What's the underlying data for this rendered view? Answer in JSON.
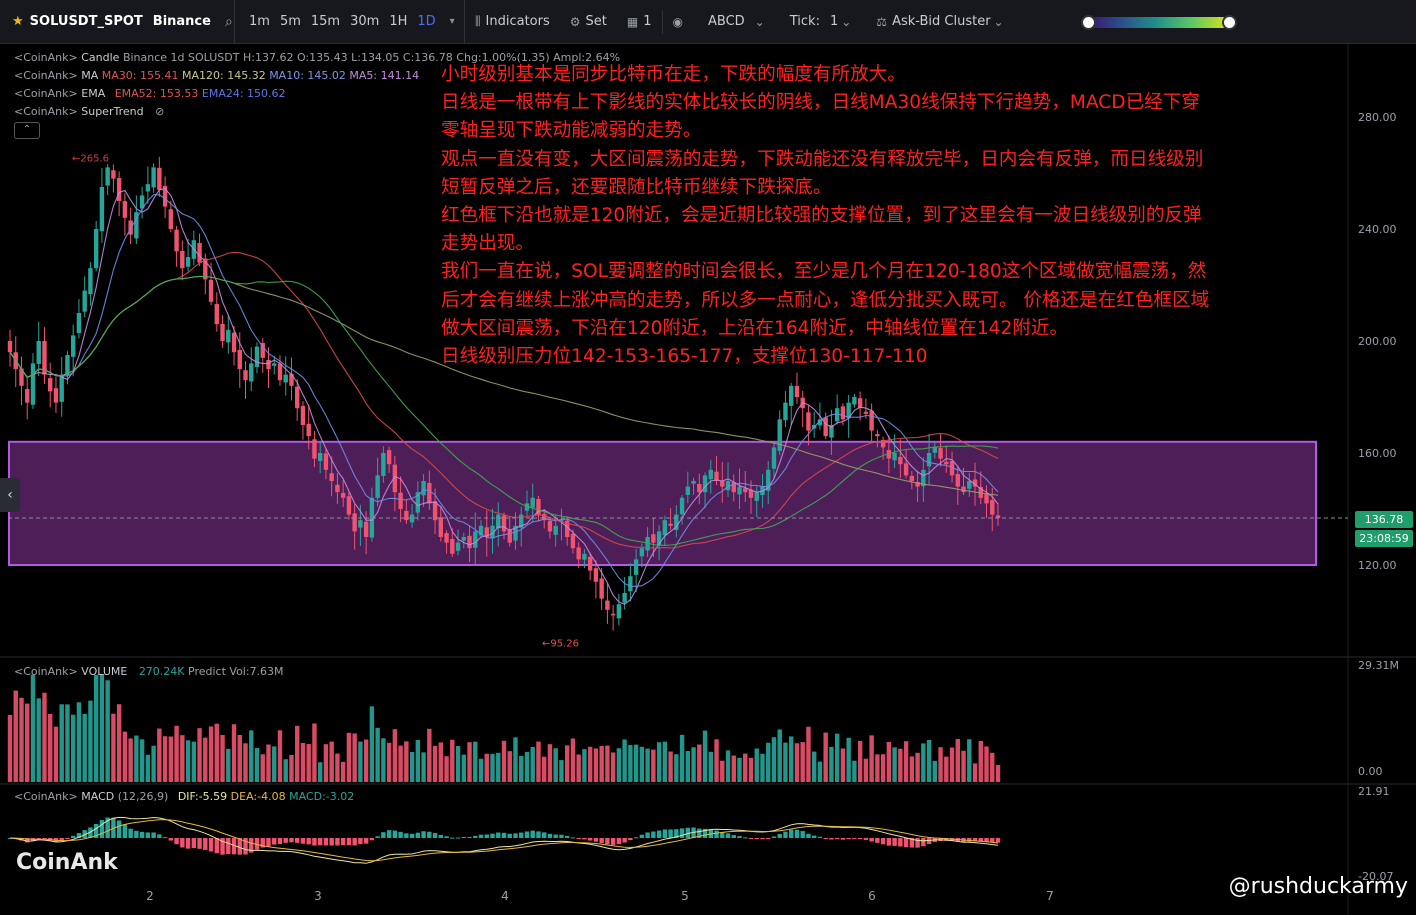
{
  "toolbar": {
    "symbol": "SOLUSDT_SPOT",
    "exchange": "Binance",
    "timeframes": [
      "1m",
      "5m",
      "15m",
      "30m",
      "1H",
      "1D"
    ],
    "active_timeframe": "1D",
    "indicators_label": "Indicators",
    "set_label": "Set",
    "layout_label": "1",
    "abcd_label": "ABCD",
    "tick_label": "Tick:",
    "tick_value": "1",
    "cluster_label": "Ask-Bid Cluster"
  },
  "legend": {
    "candle": {
      "prefix": "<CoinAnk>",
      "name": "Candle",
      "info": "Binance 1d SOLUSDT",
      "values": "H:137.62  O:135.43  L:134.05  C:136.78  Chg:1.00%(1.35)  Ampl:2.64%"
    },
    "ma": {
      "prefix": "<CoinAnk>",
      "name": "MA",
      "ma30": "MA30: 155.41",
      "ma120": "MA120: 145.32",
      "ma10": "MA10: 145.02",
      "ma5": "MA5: 141.14"
    },
    "ema": {
      "prefix": "<CoinAnk>",
      "name": "EMA",
      "ema52": "EMA52: 153.53",
      "ema24": "EMA24: 150.62"
    },
    "supertrend": {
      "prefix": "<CoinAnk>",
      "name": "SuperTrend"
    },
    "volume": {
      "prefix": "<CoinAnk>",
      "name": "VOLUME",
      "value": "270.24K",
      "predict": "Predict Vol:7.63M"
    },
    "macd": {
      "prefix": "<CoinAnk>",
      "name": "MACD",
      "params": "(12,26,9)",
      "dif": "DIF:-5.59",
      "dea": "DEA:-4.08",
      "macd": "MACD:-3.02"
    }
  },
  "annotation_lines": [
    "小时级别基本是同步比特币在走，下跌的幅度有所放大。",
    "日线是一根带有上下影线的实体比较长的阴线，日线MA30线保持下行趋势，MACD已经下穿",
    "零轴呈现下跌动能减弱的走势。",
    "观点一直没有变，大区间震荡的走势，下跌动能还没有释放完毕，日内会有反弹，而日线级别",
    "短暂反弹之后，还要跟随比特币继续下跌探底。",
    "红色框下沿也就是120附近，会是近期比较强的支撑位置，到了这里会有一波日线级别的反弹",
    "走势出现。",
    "我们一直在说，SOL要调整的时间会很长，至少是几个月在120-180这个区域做宽幅震荡，然",
    "后才会有继续上涨冲高的走势，所以多一点耐心，逢低分批买入既可。 价格还是在红色框区域",
    "做大区间震荡，下沿在120附近，上沿在164附近，中轴线位置在142附近。",
    "日线级别压力位142-153-165-177，支撑位130-117-110"
  ],
  "price_tag": {
    "last": "136.78",
    "countdown": "23:08:59"
  },
  "colors": {
    "up": "#26a69a",
    "down": "#ef5370",
    "box_fill": "#6b2a7a",
    "box_stroke": "#b45ae0",
    "annotation": "#ff2020"
  },
  "watermark": "CoinAnk",
  "credit": "@rushduckarmy",
  "chart_data": [
    {
      "type": "candlestick",
      "title": "SOLUSDT 1D",
      "x_ticks": [
        "2",
        "3",
        "4",
        "5",
        "6",
        "7"
      ],
      "y_ticks": [
        120,
        160,
        200,
        240,
        280
      ],
      "ylim": [
        84,
        300
      ],
      "last_price": 136.78,
      "high_marker": "265.6",
      "low_marker": "95.26",
      "highlight_zone": {
        "low": 120,
        "high": 164
      },
      "close_series": [
        196,
        190,
        184,
        178,
        192,
        200,
        188,
        182,
        178,
        188,
        195,
        202,
        210,
        218,
        226,
        240,
        255,
        262,
        258,
        250,
        244,
        238,
        246,
        252,
        256,
        262,
        254,
        248,
        240,
        232,
        226,
        230,
        236,
        228,
        222,
        214,
        206,
        200,
        204,
        196,
        190,
        186,
        192,
        198,
        194,
        190,
        192,
        186,
        188,
        184,
        176,
        170,
        166,
        158,
        160,
        154,
        150,
        146,
        144,
        138,
        132,
        136,
        130,
        144,
        152,
        160,
        156,
        146,
        140,
        136,
        138,
        146,
        150,
        142,
        136,
        130,
        128,
        124,
        128,
        130,
        126,
        132,
        134,
        130,
        134,
        138,
        132,
        128,
        134,
        138,
        142,
        144,
        138,
        136,
        132,
        134,
        136,
        130,
        126,
        122,
        124,
        118,
        114,
        108,
        104,
        102,
        106,
        110,
        116,
        122,
        126,
        130,
        128,
        132,
        136,
        134,
        138,
        144,
        148,
        150,
        146,
        152,
        154,
        150,
        148,
        150,
        146,
        148,
        146,
        144,
        146,
        148,
        154,
        162,
        172,
        178,
        184,
        180,
        176,
        168,
        170,
        172,
        166,
        170,
        176,
        172,
        178,
        180,
        176,
        174,
        168,
        166,
        162,
        158,
        160,
        156,
        152,
        150,
        148,
        154,
        160,
        162,
        158,
        156,
        152,
        148,
        146,
        150,
        148,
        144,
        142,
        138,
        136.78
      ],
      "ma_series": [
        {
          "name": "MA5",
          "color": "#c58be0"
        },
        {
          "name": "MA10",
          "color": "#6f8fe8"
        },
        {
          "name": "MA30",
          "color": "#d94a4a"
        },
        {
          "name": "MA120",
          "color": "#9aa06a"
        },
        {
          "name": "EMA52",
          "color": "#3fae4f"
        }
      ]
    },
    {
      "type": "bar",
      "title": "VOLUME",
      "y_ticks": [
        "0.00",
        "29.31M"
      ],
      "ylim": [
        0,
        29.31
      ]
    },
    {
      "type": "bar",
      "title": "MACD (12,26,9)",
      "y_ticks": [
        "21.91",
        "-20.07"
      ],
      "ylim": [
        -20.07,
        21.91
      ]
    }
  ]
}
